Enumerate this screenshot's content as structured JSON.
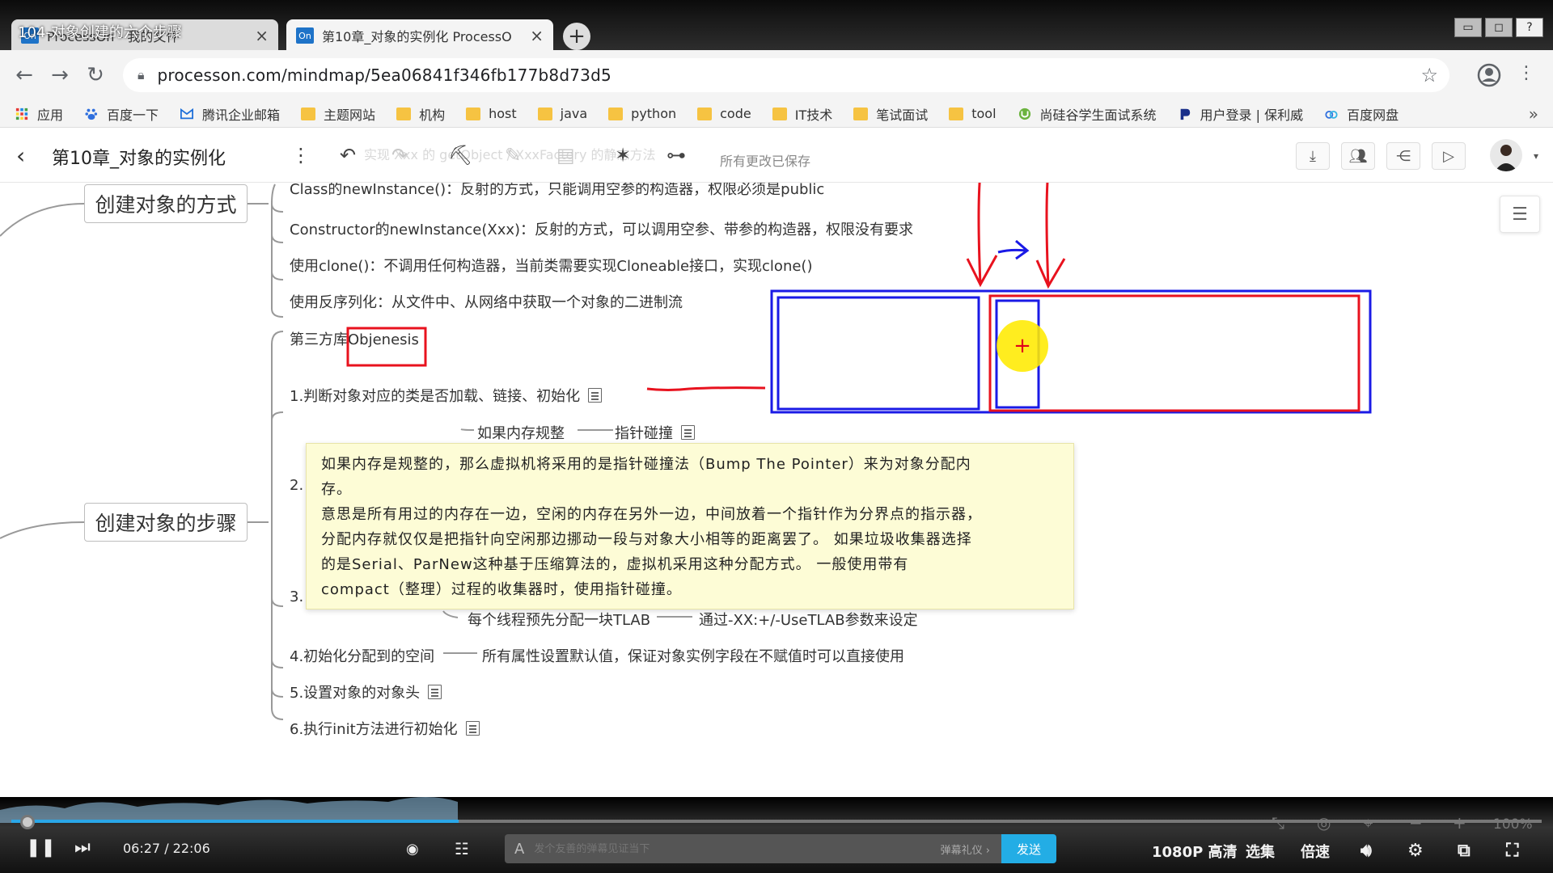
{
  "overlay": {
    "video_title": "104-对象创建的六个步骤"
  },
  "tabs": [
    {
      "favicon": "On",
      "label": "ProcessOn - 我的文件",
      "close": "×"
    },
    {
      "favicon": "On",
      "label": "第10章_对象的实例化 ProcessO",
      "close": "×"
    }
  ],
  "new_tab": "+",
  "window_buttons": {
    "minimize": "▭",
    "restore": "◻",
    "help": "?"
  },
  "nav": {
    "url": "processon.com/mindmap/5ea06841f346fb177b8d73d5"
  },
  "bookmarks": [
    {
      "label": "应用",
      "icon": "apps-grid-icon"
    },
    {
      "label": "百度一下",
      "icon": "baidu-paw-icon"
    },
    {
      "label": "腾讯企业邮箱",
      "icon": "tencent-mail-icon"
    },
    {
      "label": "主题网站",
      "icon": "folder-icon"
    },
    {
      "label": "机构",
      "icon": "folder-icon"
    },
    {
      "label": "host",
      "icon": "folder-icon"
    },
    {
      "label": "java",
      "icon": "folder-icon"
    },
    {
      "label": "python",
      "icon": "folder-icon"
    },
    {
      "label": "code",
      "icon": "folder-icon"
    },
    {
      "label": "IT技术",
      "icon": "folder-icon"
    },
    {
      "label": "笔试面试",
      "icon": "folder-icon"
    },
    {
      "label": "tool",
      "icon": "folder-icon"
    },
    {
      "label": "尚硅谷学生面试系统",
      "icon": "shangguigu-icon"
    },
    {
      "label": "用户登录 | 保利威",
      "icon": "polyv-icon"
    },
    {
      "label": "百度网盘",
      "icon": "baidu-netdisk-icon"
    }
  ],
  "bookmarks_more": "»",
  "app": {
    "title": "第10章_对象的实例化",
    "saved_status": "所有更改已保存",
    "faded_hint": "实现 Xxx 的 getObject / XxxFactory 的静态方法"
  },
  "mindmap": {
    "branch1": {
      "label": "创建对象的方式",
      "items": [
        "Class的newInstance()：反射的方式，只能调用空参的构造器，权限必须是public",
        "Constructor的newInstance(Xxx)：反射的方式，可以调用空参、带参的构造器，权限没有要求",
        "使用clone()：不调用任何构造器，当前类需要实现Cloneable接口，实现clone()",
        "使用反序列化：从文件中、从网络中获取一个对象的二进制流",
        "第三方库Objenesis"
      ]
    },
    "branch2": {
      "label": "创建对象的步骤",
      "step1": "1.判断对象对应的类是否加载、链接、初始化",
      "step2_partial": "2.",
      "step2_sub": "如果内存规整",
      "step2_sub_child": "指针碰撞",
      "step3_partial": "3.",
      "tlab_label": "每个线程预先分配一块TLAB",
      "tlab_child": "通过-XX:+/-UseTLAB参数来设定",
      "step4": "4.初始化分配到的空间",
      "step4_child": "所有属性设置默认值，保证对象实例字段在不赋值时可以直接使用",
      "step5": "5.设置对象的对象头",
      "step6": "6.执行init方法进行初始化"
    },
    "tooltip": {
      "line1": "如果内存是规整的，那么虚拟机将采用的是指针碰撞法（Bump The Pointer）来为对象分配内",
      "line2": "存。",
      "line3": "意思是所有用过的内存在一边，空闲的内存在另外一边，中间放着一个指针作为分界点的指示器，",
      "line4": "分配内存就仅仅是把指针向空闲那边挪动一段与对象大小相等的距离罢了。 如果垃圾收集器选择",
      "line5": "的是Serial、ParNew这种基于压缩算法的，虚拟机采用这种分配方式。 一般使用带有",
      "line6": "compact（整理）过程的收集器时，使用指针碰撞。"
    },
    "cursor_symbol": "+"
  },
  "player": {
    "time": "06:27 / 22:06",
    "progress": 0.2925,
    "danmaku_placeholder": "发个友善的弹幕见证当下",
    "danmaku_etiquette": "弹幕礼仪 ›",
    "send": "发送",
    "quality": "1080P 高清",
    "episodes": "选集",
    "speed": "倍速",
    "zoom": "100%"
  },
  "colors": {
    "accent_blue": "#23ade5",
    "annotation_red": "#e8121e",
    "annotation_blue": "#1a1ae6",
    "tooltip_bg": "#fdfcd6"
  }
}
